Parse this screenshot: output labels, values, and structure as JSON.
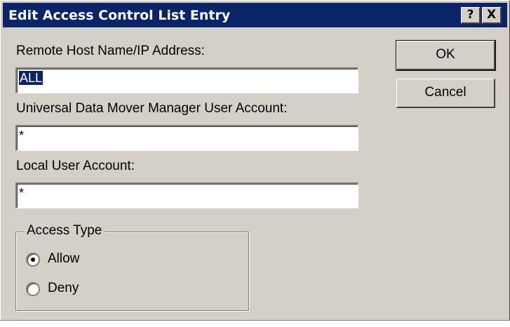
{
  "window": {
    "title": "Edit Access Control List Entry",
    "help_label": "?",
    "close_label": "X"
  },
  "form": {
    "remote_host": {
      "label": "Remote Host Name/IP Address:",
      "value": "ALL"
    },
    "udm_account": {
      "label": "Universal Data Mover Manager User Account:",
      "value": "*"
    },
    "local_account": {
      "label": "Local User Account:",
      "value": "*"
    }
  },
  "access_type": {
    "legend": "Access Type",
    "options": [
      {
        "label": "Allow",
        "selected": true
      },
      {
        "label": "Deny",
        "selected": false
      }
    ]
  },
  "buttons": {
    "ok_label": "OK",
    "cancel_label": "Cancel"
  },
  "colors": {
    "titlebar": "#0a246a",
    "dialog_face": "#d4d0c8",
    "selection": "#0a246a"
  }
}
